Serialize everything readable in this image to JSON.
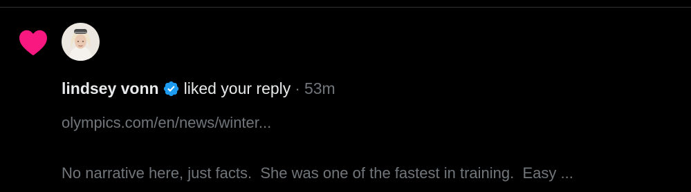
{
  "notification": {
    "icon": "heart-icon",
    "icon_color": "#f91880",
    "avatar": "avatar-photo",
    "user_name": "lindsey vonn",
    "verified_icon": "verified-badge-icon",
    "verified_color": "#1d9bf0",
    "action_text": "liked your reply",
    "separator": "·",
    "time_ago": "53m",
    "link_text": "olympics.com/en/news/winter...",
    "reply_text": "No narrative here, just facts.  She was one of the fastest in training.  Easy ..."
  }
}
